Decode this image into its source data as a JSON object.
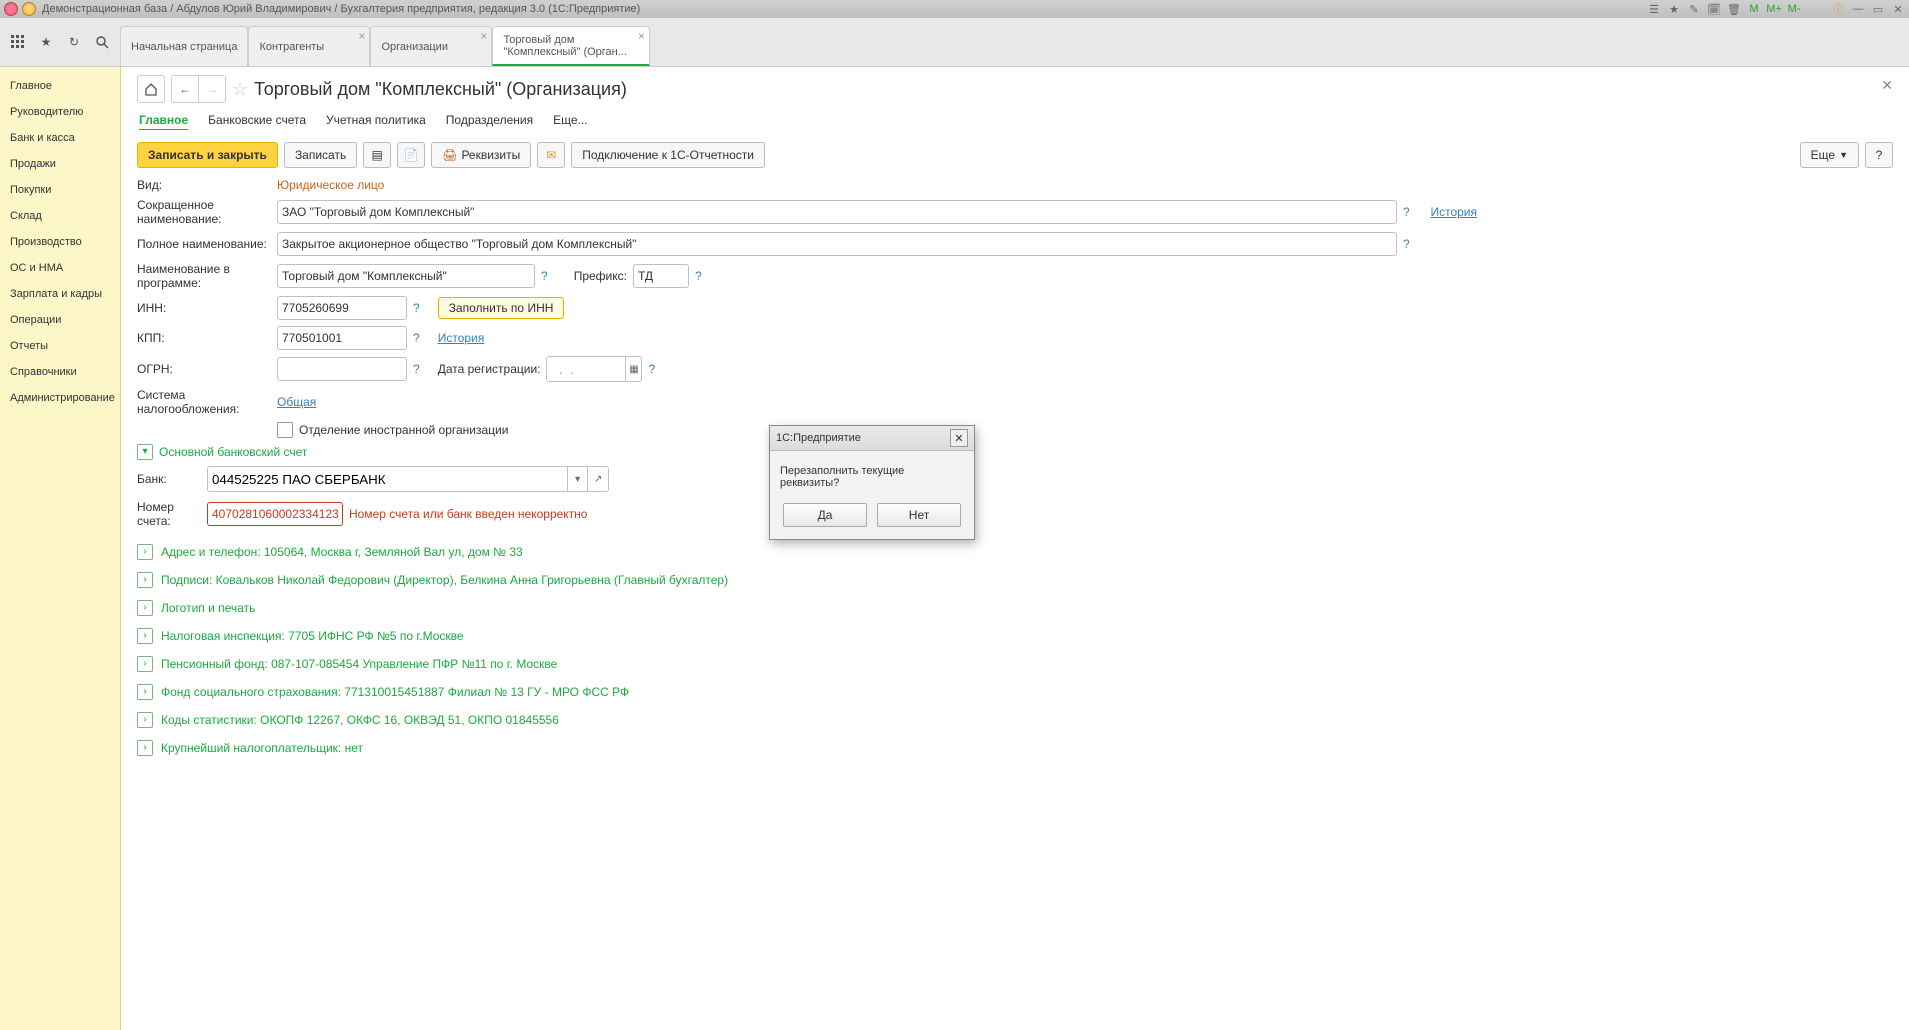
{
  "window_title": "Демонстрационная база / Абдулов Юрий Владимирович / Бухгалтерия предприятия, редакция 3.0  (1С:Предприятие)",
  "tabs": [
    {
      "label": "Начальная страница"
    },
    {
      "label": "Контрагенты"
    },
    {
      "label": "Организации"
    },
    {
      "label": "Торговый дом",
      "label2": "\"Комплексный\" (Орган..."
    }
  ],
  "sidebar": [
    "Главное",
    "Руководителю",
    "Банк и касса",
    "Продажи",
    "Покупки",
    "Склад",
    "Производство",
    "ОС и НМА",
    "Зарплата и кадры",
    "Операции",
    "Отчеты",
    "Справочники",
    "Администрирование"
  ],
  "page_title": "Торговый дом \"Комплексный\" (Организация)",
  "section_tabs": [
    "Главное",
    "Банковские счета",
    "Учетная политика",
    "Подразделения",
    "Еще..."
  ],
  "toolbar": {
    "save_close": "Записать и закрыть",
    "save": "Записать",
    "rekvizity": "Реквизиты",
    "connect_1c": "Подключение к 1С-Отчетности",
    "more": "Еще"
  },
  "labels": {
    "vid": "Вид:",
    "vid_value": "Юридическое лицо",
    "short_name": "Сокращенное наименование:",
    "full_name": "Полное наименование:",
    "prog_name": "Наименование в программе:",
    "prefix": "Префикс:",
    "inn": "ИНН:",
    "fill_by_inn": "Заполнить по ИНН",
    "kpp": "КПП:",
    "history": "История",
    "ogrn": "ОГРН:",
    "reg_date": "Дата регистрации:",
    "tax_system": "Система налогообложения:",
    "tax_value": "Общая",
    "foreign": "Отделение иностранной организации",
    "main_bank": "Основной банковский счет",
    "bank": "Банк:",
    "account": "Номер счета:",
    "account_err": "Номер счета или банк введен некорректно"
  },
  "values": {
    "short_name": "ЗАО \"Торговый дом Комплексный\"",
    "full_name": "Закрытое акционерное общество \"Торговый дом Комплексный\"",
    "prog_name": "Торговый дом \"Комплексный\"",
    "prefix": "ТД",
    "inn": "7705260699",
    "kpp": "770501001",
    "ogrn": "",
    "reg_date": "  .  .    ",
    "bank": "044525225 ПАО СБЕРБАНК",
    "account": "4070281060002334123"
  },
  "expandables": [
    "Адрес и телефон: 105064, Москва г, Земляной Вал ул, дом № 33",
    "Подписи: Ковальков  Николай Федорович (Директор), Белкина Анна  Григорьевна (Главный бухгалтер)",
    "Логотип и печать",
    "Налоговая инспекция: 7705 ИФНС РФ №5 по г.Москве",
    "Пенсионный фонд: 087-107-085454 Управление ПФР №11 по г. Москве",
    "Фонд социального страхования: 771310015451887 Филиал № 13 ГУ - МРО ФСС РФ",
    "Коды статистики: ОКОПФ 12267, ОКФС 16, ОКВЭД 51, ОКПО 01845556",
    "Крупнейший налогоплательщик: нет"
  ],
  "dialog": {
    "title": "1С:Предприятие",
    "text": "Перезаполнить текущие реквизиты?",
    "yes": "Да",
    "no": "Нет"
  },
  "history_link": "История"
}
